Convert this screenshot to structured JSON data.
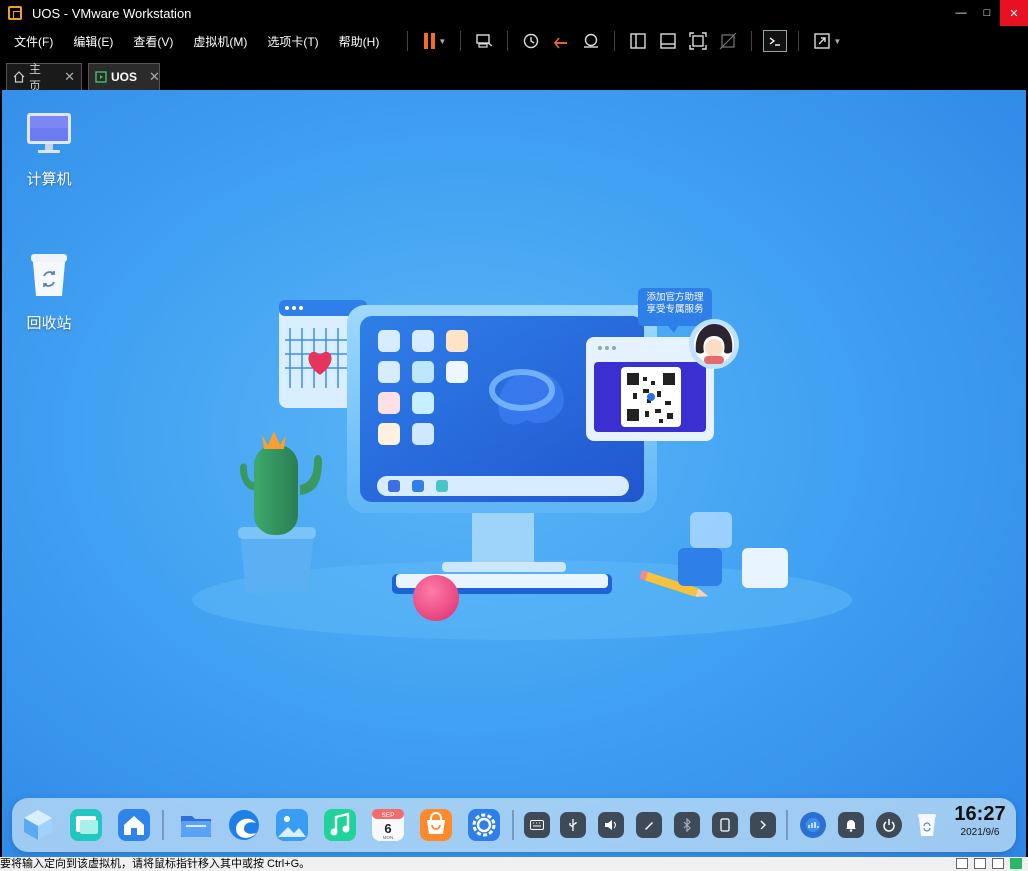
{
  "window": {
    "title": "UOS - VMware Workstation"
  },
  "menu": [
    "文件(F)",
    "编辑(E)",
    "查看(V)",
    "虚拟机(M)",
    "选项卡(T)",
    "帮助(H)"
  ],
  "tabs": [
    {
      "label": "主页",
      "icon": "home-icon",
      "active": false
    },
    {
      "label": "UOS",
      "icon": "vm-icon",
      "active": true
    }
  ],
  "desktop": {
    "icons": [
      {
        "label": "计算机",
        "icon": "computer-icon"
      },
      {
        "label": "回收站",
        "icon": "trash-icon"
      }
    ],
    "qr_caption": {
      "line1": "添加官方助理",
      "line2": "享受专属服务"
    },
    "calendar_month": "SEP",
    "calendar_day": "6",
    "calendar_weekday": "MON"
  },
  "dock": {
    "apps": [
      "multitask-view-icon",
      "workspace-icon",
      "launcher-icon",
      "file-manager-icon",
      "browser-icon",
      "image-viewer-icon",
      "music-icon",
      "calendar-icon",
      "app-store-icon",
      "settings-icon"
    ],
    "tray": [
      "keyboard-icon",
      "usb-icon",
      "volume-icon",
      "pen-icon",
      "bluetooth-icon",
      "phone-icon",
      "expand-arrow-icon",
      "network-icon",
      "notification-icon",
      "power-icon",
      "trash-icon"
    ],
    "time": "16:27",
    "date": "2021/9/6"
  },
  "statusbar": {
    "hint": "要将输入定向到该虚拟机，请将鼠标指针移入其中或按 Ctrl+G。"
  },
  "colors": {
    "desktop": "#42a2f2",
    "close": "#e81123",
    "pause": "#f07020"
  }
}
